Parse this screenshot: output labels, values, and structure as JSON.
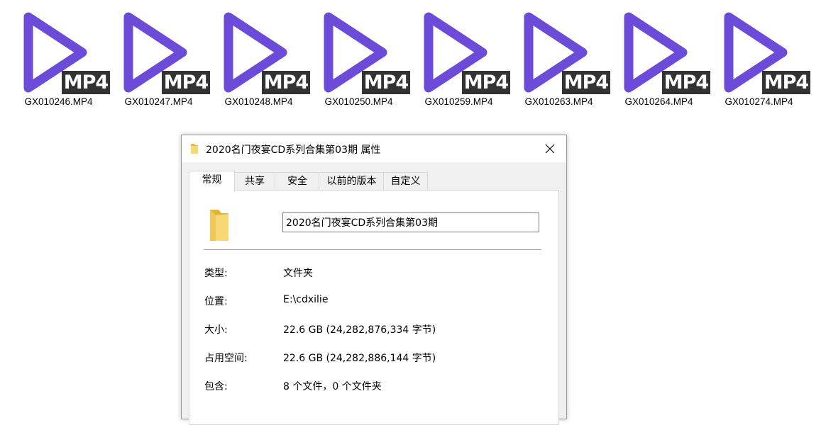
{
  "accent_color": "#6b4bd8",
  "files": [
    {
      "name": "GX010246.MP4",
      "ext": "MP4",
      "icon": "mp4-play-icon"
    },
    {
      "name": "GX010247.MP4",
      "ext": "MP4",
      "icon": "mp4-play-icon"
    },
    {
      "name": "GX010248.MP4",
      "ext": "MP4",
      "icon": "mp4-play-icon"
    },
    {
      "name": "GX010250.MP4",
      "ext": "MP4",
      "icon": "mp4-play-icon"
    },
    {
      "name": "GX010259.MP4",
      "ext": "MP4",
      "icon": "mp4-play-icon"
    },
    {
      "name": "GX010263.MP4",
      "ext": "MP4",
      "icon": "mp4-play-icon"
    },
    {
      "name": "GX010264.MP4",
      "ext": "MP4",
      "icon": "mp4-play-icon"
    },
    {
      "name": "GX010274.MP4",
      "ext": "MP4",
      "icon": "mp4-play-icon"
    }
  ],
  "dialog": {
    "title": "2020名门夜宴CD系列合集第03期 属性",
    "tabs": [
      {
        "label": "常规",
        "active": true
      },
      {
        "label": "共享",
        "active": false
      },
      {
        "label": "安全",
        "active": false
      },
      {
        "label": "以前的版本",
        "active": false
      },
      {
        "label": "自定义",
        "active": false
      }
    ],
    "folder_name": "2020名门夜宴CD系列合集第03期",
    "properties": [
      {
        "label": "类型:",
        "value": "文件夹"
      },
      {
        "label": "位置:",
        "value": "E:\\cdxilie"
      },
      {
        "label": "大小:",
        "value": "22.6 GB (24,282,876,334 字节)"
      },
      {
        "label": "占用空间:",
        "value": "22.6 GB (24,282,886,144 字节)"
      },
      {
        "label": "包含:",
        "value": "8 个文件，0 个文件夹"
      }
    ]
  }
}
